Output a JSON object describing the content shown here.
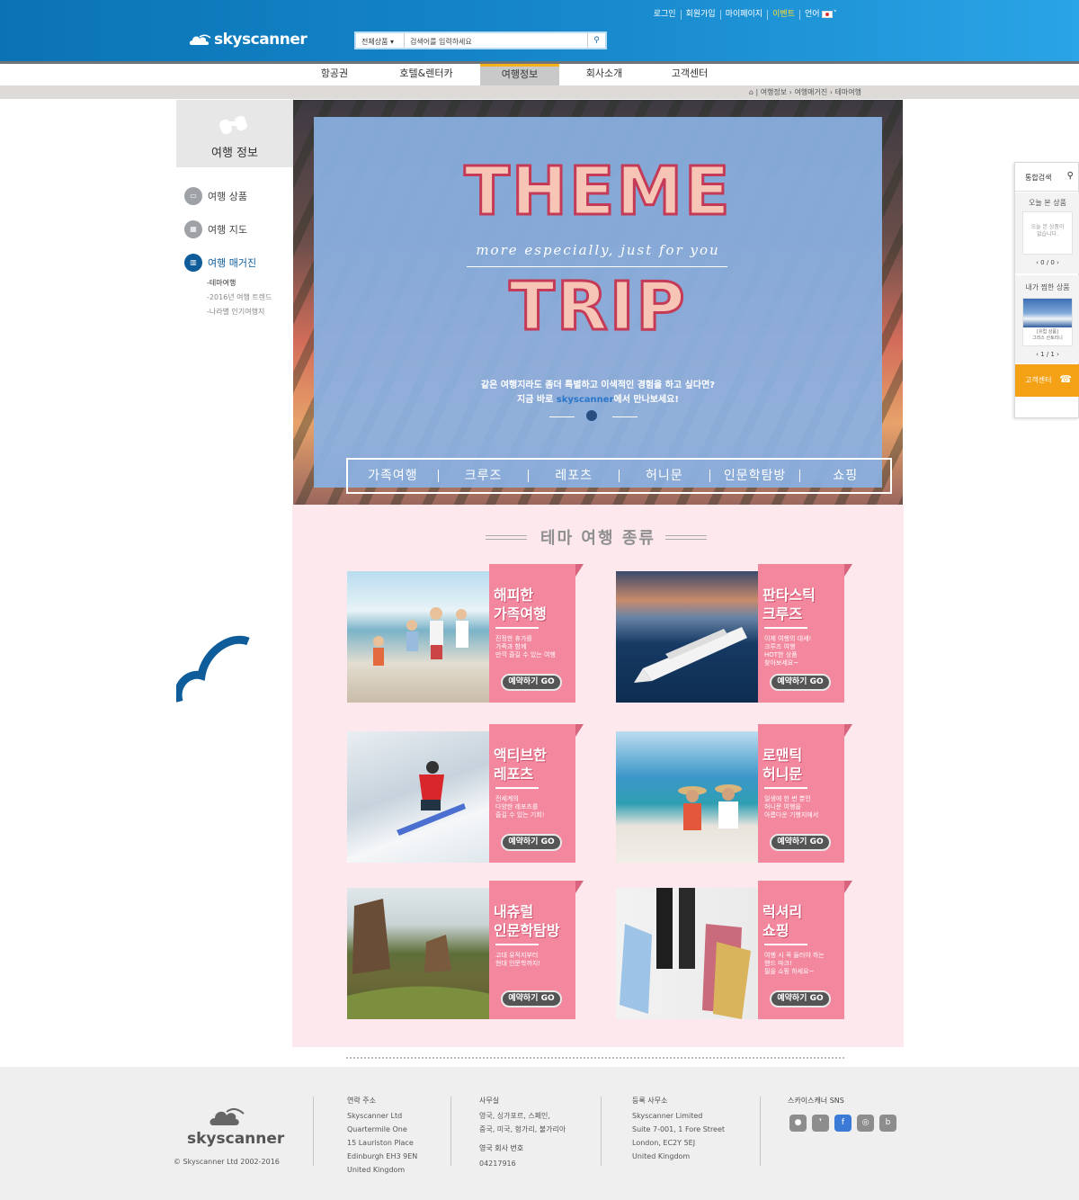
{
  "brand": {
    "name": "skyscanner",
    "copyright": "© Skyscanner Ltd 2002-2016"
  },
  "top_links": [
    "로그인",
    "회원가입",
    "마이페이지",
    "이벤트",
    "언어"
  ],
  "search": {
    "category": "전체상품 ▾",
    "query": "검색어를 입력하세요"
  },
  "gnb": [
    "항공권",
    "호텔&렌터카",
    "여행정보",
    "회사소개",
    "고객센터"
  ],
  "breadcrumb": [
    "여행정보",
    "여행매거진",
    "테마여행"
  ],
  "lnb": {
    "title": "여행 정보",
    "items": [
      "여행 상품",
      "여행 지도",
      "여행 매거진"
    ],
    "sub": [
      "-테마여행",
      "-2016년 여행 트렌드",
      "-나라별 인기여행지"
    ]
  },
  "hero": {
    "word1": "THEME",
    "tagline": "more especially, just for you",
    "word2": "TRIP",
    "copy1": "같은 여행지라도 좀더 특별하고 이색적인 경험을 하고 싶다면?",
    "copy2_pre": "지금 바로 ",
    "copy2_brand": "skyscanner",
    "copy2_post": "에서 만나보세요!",
    "tabs": [
      "가족여행",
      "크루즈",
      "레포츠",
      "허니문",
      "인문학탐방",
      "쇼핑"
    ]
  },
  "types": {
    "title": "테마 여행 종류",
    "go": "예약하기 GO",
    "cards": [
      {
        "t1": "해피한",
        "t2": "가족여행",
        "desc": [
          "진정한 휴가를",
          "가족과 함께",
          "만끽 즐길 수 있는 여행"
        ]
      },
      {
        "t1": "판타스틱",
        "t2": "크루즈",
        "desc": [
          "이제 여행의 대세!",
          "크루즈 여행",
          "HOT한 상품",
          "찾아보세요~"
        ]
      },
      {
        "t1": "액티브한",
        "t2": "레포츠",
        "desc": [
          "전세계의",
          "다양한 레포츠를",
          "즐길 수 있는 기회!"
        ]
      },
      {
        "t1": "로맨틱",
        "t2": "허니문",
        "desc": [
          "일생에 한 번 뿐인",
          "허니문 여행을",
          "아름다운 기행지에서"
        ]
      },
      {
        "t1": "내츄럴",
        "t2": "인문학탐방",
        "desc": [
          "고대 유적지부터",
          "현대 인문학까지!"
        ]
      },
      {
        "t1": "럭셔리",
        "t2": "쇼핑",
        "desc": [
          "여행 시 꼭 들러야 하는",
          "핸드 마크!",
          "필을 쇼핑 하세요~"
        ]
      }
    ]
  },
  "quick": {
    "search": "통합검색",
    "today": "오늘 본 상품",
    "empty": [
      "오늘 본 상품이",
      "없습니다."
    ],
    "pager1": "‹ 0 / 0 ›",
    "wish": "내가 찜한 상품",
    "wish_item": [
      "[유럽 상품]",
      "그리스 산토리니"
    ],
    "pager2": "‹ 1 / 1 ›",
    "cs": "고객센터"
  },
  "footer": {
    "contact": {
      "h": "연락 주소",
      "lines": [
        "Skyscanner Ltd",
        "Quartermile One",
        "15 Lauriston Place",
        "Edinburgh EH3 9EN",
        "United Kingdom"
      ]
    },
    "office": {
      "h": "사무실",
      "lines": [
        "영국, 싱가포르, 스페인,",
        "중국, 미국, 헝가리, 불가리아"
      ],
      "reg_h": "영국 회사 번호",
      "reg": "04217916"
    },
    "registered": {
      "h": "등록 사무소",
      "lines": [
        "Skyscanner Limited",
        "Suite 7-001, 1 Fore Street",
        "London, EC2Y 5EJ",
        "United Kingdom"
      ]
    },
    "sns": {
      "h": "스카이스캐너 SNS",
      "icons": [
        "kakaotalk-icon",
        "kakaostory-icon",
        "facebook-icon",
        "instagram-icon",
        "blog-icon"
      ]
    }
  },
  "colors": {
    "header": "#1789cc",
    "accent": "#f5b21b",
    "pink_band": "#f2879e",
    "quick_cs": "#f5a115"
  }
}
